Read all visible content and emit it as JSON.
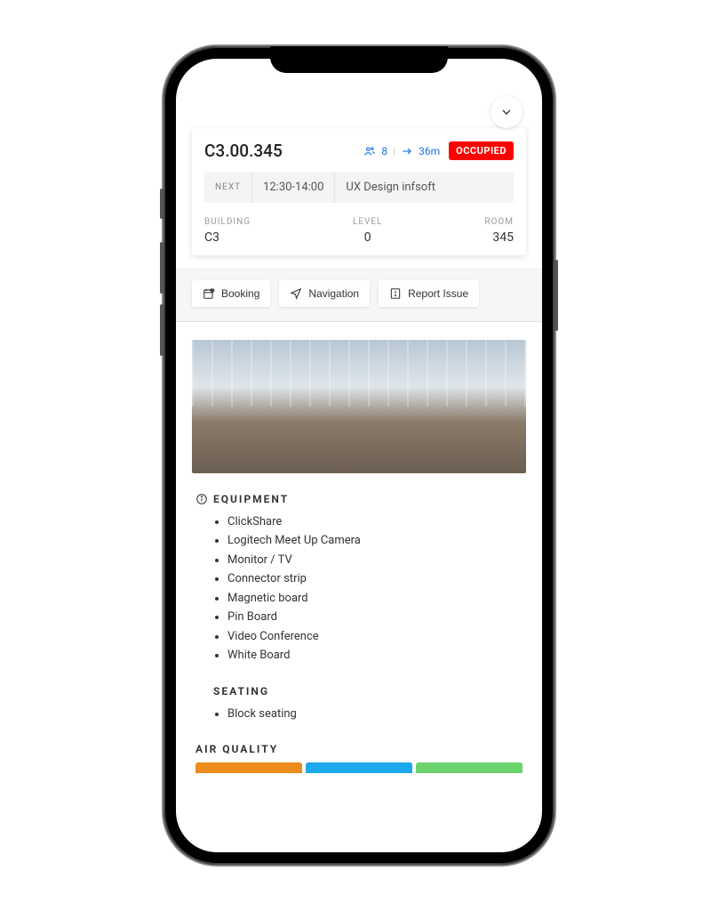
{
  "room": {
    "id": "C3.00.345",
    "capacity": "8",
    "distance": "36m",
    "status": "OCCUPIED"
  },
  "next": {
    "label": "NEXT",
    "time": "12:30-14:00",
    "title": "UX Design infsoft"
  },
  "location": {
    "building_label": "BUILDING",
    "building": "C3",
    "level_label": "LEVEL",
    "level": "0",
    "room_label": "ROOM",
    "room": "345"
  },
  "actions": {
    "booking": "Booking",
    "navigation": "Navigation",
    "report": "Report Issue"
  },
  "equipment": {
    "title": "EQUIPMENT",
    "items": [
      "ClickShare",
      "Logitech Meet Up Camera",
      "Monitor / TV",
      "Connector strip",
      "Magnetic board",
      "Pin Board",
      "Video Conference",
      "White Board"
    ]
  },
  "seating": {
    "title": "SEATING",
    "items": [
      "Block seating"
    ]
  },
  "air": {
    "title": "AIR QUALITY"
  },
  "colors": {
    "status": "#ff0000",
    "accent": "#1a73e8"
  }
}
